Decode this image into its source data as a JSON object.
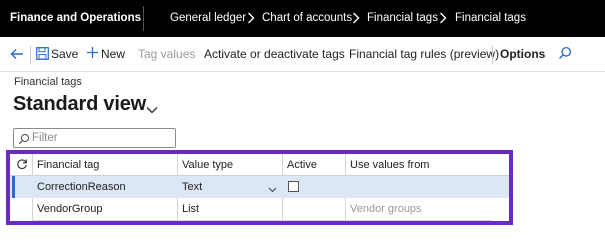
{
  "navbar": {
    "app_title": "Finance and Operations",
    "breadcrumbs": [
      "General ledger",
      "Chart of accounts",
      "Financial tags",
      "Financial tags"
    ]
  },
  "actionbar": {
    "save_label": "Save",
    "new_label": "New",
    "tag_values_label": "Tag values",
    "activate_label": "Activate or deactivate tags",
    "rules_label": "Financial tag rules (preview)",
    "options_label": "Options"
  },
  "page": {
    "subtitle": "Financial tags",
    "view_name": "Standard view"
  },
  "filter": {
    "placeholder": "Filter"
  },
  "grid": {
    "columns": [
      "Financial tag",
      "Value type",
      "Active",
      "Use values from"
    ],
    "rows": [
      {
        "financial_tag": "CorrectionReason",
        "value_type": "Text",
        "active": false,
        "use_values_from": ""
      },
      {
        "financial_tag": "VendorGroup",
        "value_type": "List",
        "active": "",
        "use_values_from": "Vendor groups"
      }
    ]
  },
  "colors": {
    "navbar_bg": "#000000",
    "highlight_border": "#6b2bbf",
    "selected_row": "#dbe7f5",
    "accent": "#2b6cc4"
  }
}
